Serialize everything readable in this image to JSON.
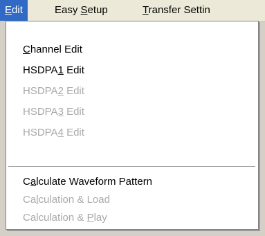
{
  "menubar": {
    "items": [
      {
        "pre": "",
        "acc": "E",
        "post": "dit"
      },
      {
        "pre": "Easy ",
        "acc": "S",
        "post": "etup"
      },
      {
        "pre": "",
        "acc": "T",
        "post": "ransfer Settin"
      }
    ]
  },
  "edit_menu": {
    "items": [
      {
        "pre": "",
        "acc": "C",
        "post": "hannel Edit",
        "enabled": true
      },
      {
        "pre": "HSDPA",
        "acc": "1",
        "post": " Edit",
        "enabled": true
      },
      {
        "pre": "HSDPA",
        "acc": "2",
        "post": " Edit",
        "enabled": false
      },
      {
        "pre": "HSDPA",
        "acc": "3",
        "post": " Edit",
        "enabled": false
      },
      {
        "pre": "HSDPA",
        "acc": "4",
        "post": " Edit",
        "enabled": false
      },
      {
        "pre": "C",
        "acc": "a",
        "post": "lculate Waveform Pattern",
        "enabled": true
      },
      {
        "pre": "Ca",
        "acc": "l",
        "post": "culation & Load",
        "enabled": false
      },
      {
        "pre": "Calculation & ",
        "acc": "P",
        "post": "lay",
        "enabled": false
      }
    ]
  },
  "colors": {
    "menubar_bg": "#ece9d8",
    "highlight": "#316ac5",
    "menu_bg": "#ffffff",
    "disabled_text": "#a9a9a9"
  }
}
